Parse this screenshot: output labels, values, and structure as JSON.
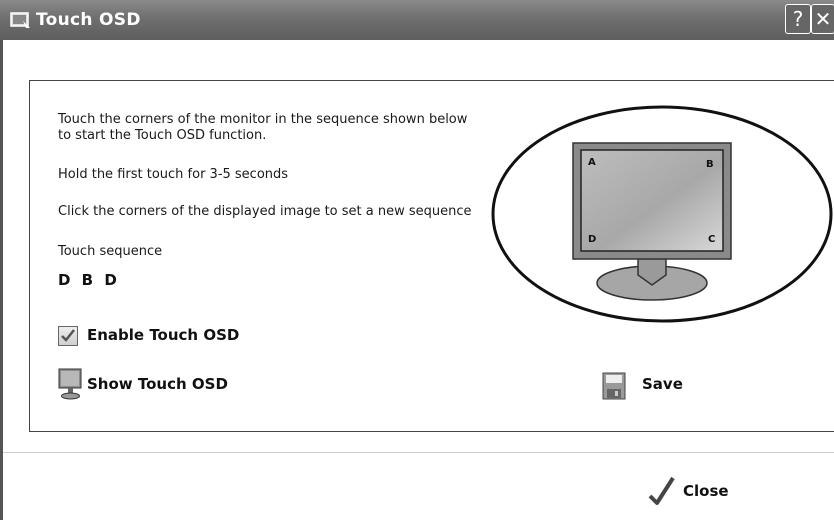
{
  "window": {
    "title": "Touch OSD",
    "help_label": "?",
    "close_label": "✕"
  },
  "instructions": {
    "line1": "Touch the corners of the monitor in the sequence shown below",
    "line2": "to start the Touch OSD function.",
    "hold": "Hold the first touch for 3-5 seconds",
    "click": "Click the corners of the displayed image to set a new sequence"
  },
  "sequence": {
    "label": "Touch sequence",
    "value": "D B D"
  },
  "monitor_image": {
    "corner_a": "A",
    "corner_b": "B",
    "corner_c": "C",
    "corner_d": "D"
  },
  "options": {
    "enable_label": "Enable Touch OSD",
    "enable_checked": true,
    "show_label": "Show Touch OSD",
    "save_label": "Save"
  },
  "footer": {
    "close_label": "Close"
  }
}
